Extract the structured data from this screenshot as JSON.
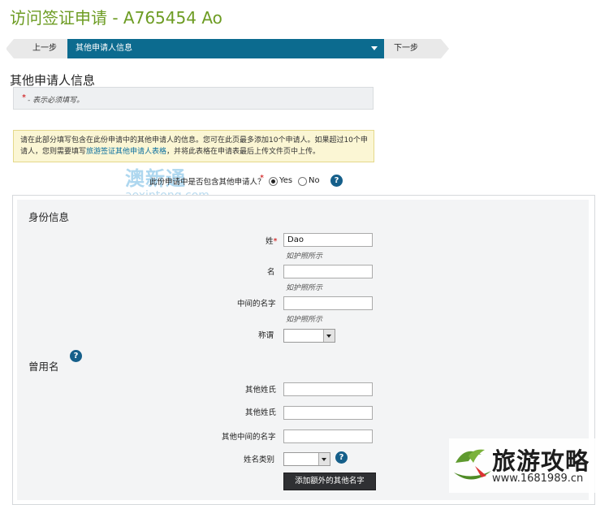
{
  "app": {
    "title": "访问签证申请 - A765454 Ao"
  },
  "steps": {
    "prev": "上一步",
    "current": "其他申请人信息",
    "next": "下一步"
  },
  "section": {
    "title": "其他申请人信息",
    "required_star": "*",
    "required_note": "- 表示必须填写。"
  },
  "info": {
    "text_before": "请在此部分填写包含在此份申请中的其他申请人的信息。您可在此页最多添加10个申请人。如果超过10个申请人，您则需要填写",
    "link": "旅游签证其他申请人表格",
    "text_after": "，并将此表格在申请表最后上传文件页中上传。"
  },
  "watermark": {
    "cn": "澳新通",
    "en": "aoxintong.com"
  },
  "question": {
    "text": "此份申请中是否包含其他申请人？",
    "star": "*",
    "yes": "Yes",
    "no": "No",
    "selected": "Yes"
  },
  "identity": {
    "title": "身份信息",
    "surname_label": "姓",
    "surname_star": "*",
    "surname_value": "Dao",
    "surname_hint": "如护照所示",
    "given_label": "名",
    "given_hint": "如护照所示",
    "middle_label": "中间的名字",
    "middle_hint": "如护照所示",
    "title_label": "称谓"
  },
  "former": {
    "title": "曾用名",
    "other_surname": "其他姓氏",
    "other_given": "其他姓氏",
    "other_middle": "其他中间的名字",
    "name_type": "姓名类别",
    "add_button": "添加额外的其他名字"
  },
  "brand": {
    "name": "旅游攻略",
    "url": "www.1681989.cn"
  },
  "colors": {
    "title_green": "#6d9c23",
    "step_blue": "#0c6b8f",
    "help_blue": "#155f8a",
    "required_red": "#cc0000"
  }
}
